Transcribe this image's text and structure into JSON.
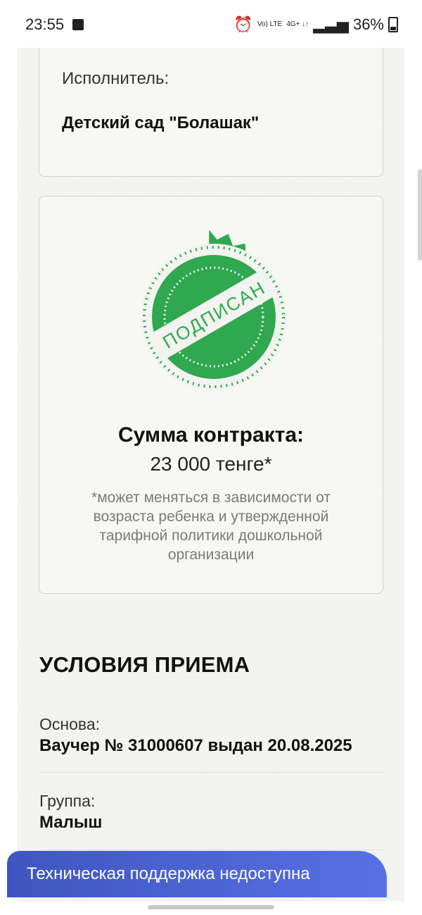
{
  "status_bar": {
    "time": "23:55",
    "network_label_1": "Vo)\nLTE",
    "network_label_2": "4G+\n↓↑",
    "battery_percent": "36%"
  },
  "contract": {
    "executor_label": "Исполнитель:",
    "executor_name": "Детский сад \"Болашак\"",
    "stamp_text": "ПОДПИСАН",
    "amount_title": "Сумма контракта:",
    "amount_value": "23 000 тенге*",
    "amount_note": "*может меняться в зависимости от возраста ребенка и утвержденной тарифной политики дошкольной организации"
  },
  "conditions": {
    "title": "УСЛОВИЯ ПРИЕМА",
    "basis_label": "Основа:",
    "basis_value": "Ваучер № 31000607 выдан 20.08.2025",
    "group_label": "Группа:",
    "group_value": "Малыш"
  },
  "support": {
    "banner_text": "Техническая поддержка недоступна"
  },
  "colors": {
    "stamp_green": "#2fa84f",
    "banner_blue": "#4d63d5"
  }
}
